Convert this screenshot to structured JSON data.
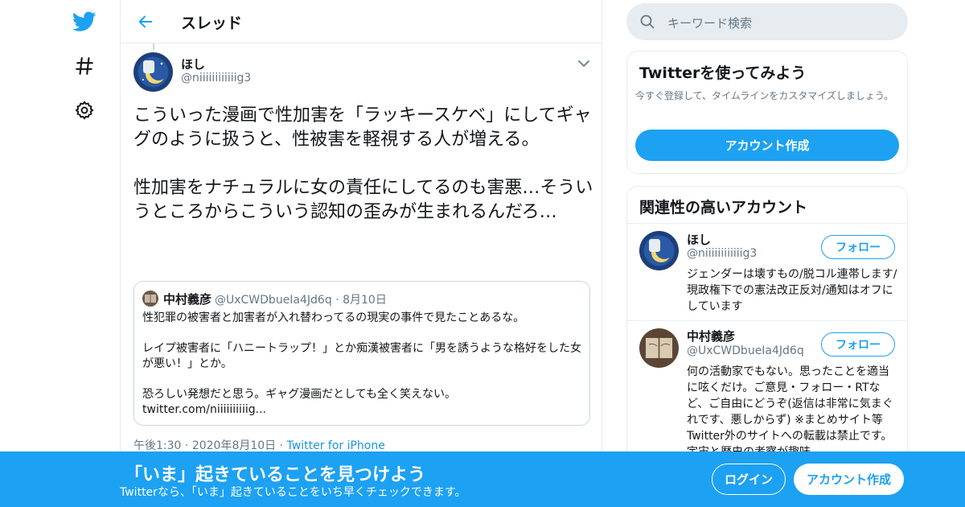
{
  "colors": {
    "accent": "#1da1f2",
    "muted": "#657786",
    "border": "#e6ecf0"
  },
  "nav": {
    "icons": [
      "twitter-bird-icon",
      "hashtag-icon",
      "gear-icon"
    ]
  },
  "header": {
    "title": "スレッド"
  },
  "tweet": {
    "author_name": "ほし",
    "author_handle": "@niiiiiiiiiiiig3",
    "text": "こういった漫画で性加害を「ラッキースケベ」にしてギャグのように扱うと、性被害を軽視する人が増える。\n\n性加害をナチュラルに女の責任にしてるのも害悪…そういうところからこういう認知の歪みが生まれるんだろ…",
    "quote": {
      "name": "中村義彦",
      "handle": "@UxCWDbueIa4Jd6q",
      "date": "8月10日",
      "text": "性犯罪の被害者と加害者が入れ替わってるの現実の事件で見たことあるな。\n\nレイプ被害者に「ハニートラップ！」とか痴漢被害者に「男を誘うような格好をした女が悪い！」とか。\n\n恐ろしい発想だと思う。ギャグ漫画だとしても全く笑えない。\ntwitter.com/niiiiiiiiiig..."
    },
    "time": "午後1:30",
    "date": "2020年8月10日",
    "source": "Twitter for iPhone"
  },
  "search": {
    "placeholder": "キーワード検索"
  },
  "signup_card": {
    "title": "Twitterを使ってみよう",
    "subtitle": "今すぐ登録して、タイムラインをカスタマイズしましょう。",
    "button": "アカウント作成"
  },
  "related": {
    "title": "関連性の高いアカウント",
    "accounts": [
      {
        "name": "ほし",
        "handle": "@niiiiiiiiiiiig3",
        "bio": "ジェンダーは壊すもの/脱コル連帯します/現政権下での憲法改正反対/通知はオフにしています",
        "follow": "フォロー"
      },
      {
        "name": "中村義彦",
        "handle": "@UxCWDbueIa4Jd6q",
        "bio": "何の活動家でもない。思ったことを適当に呟くだけ。ご意見・フォロー・RTなど、ご自由にどうぞ(返信は非常に気まぐれです、悪しからず) ※まとめサイト等Twitter外のサイトへの転載は禁止です。宇宙と歴史の考察が趣味。",
        "follow": "フォロー"
      }
    ]
  },
  "banner": {
    "title": "「いま」起きていることを見つけよう",
    "subtitle": "Twitterなら、「いま」起きていることをいち早くチェックできます。",
    "login": "ログイン",
    "signup": "アカウント作成"
  }
}
